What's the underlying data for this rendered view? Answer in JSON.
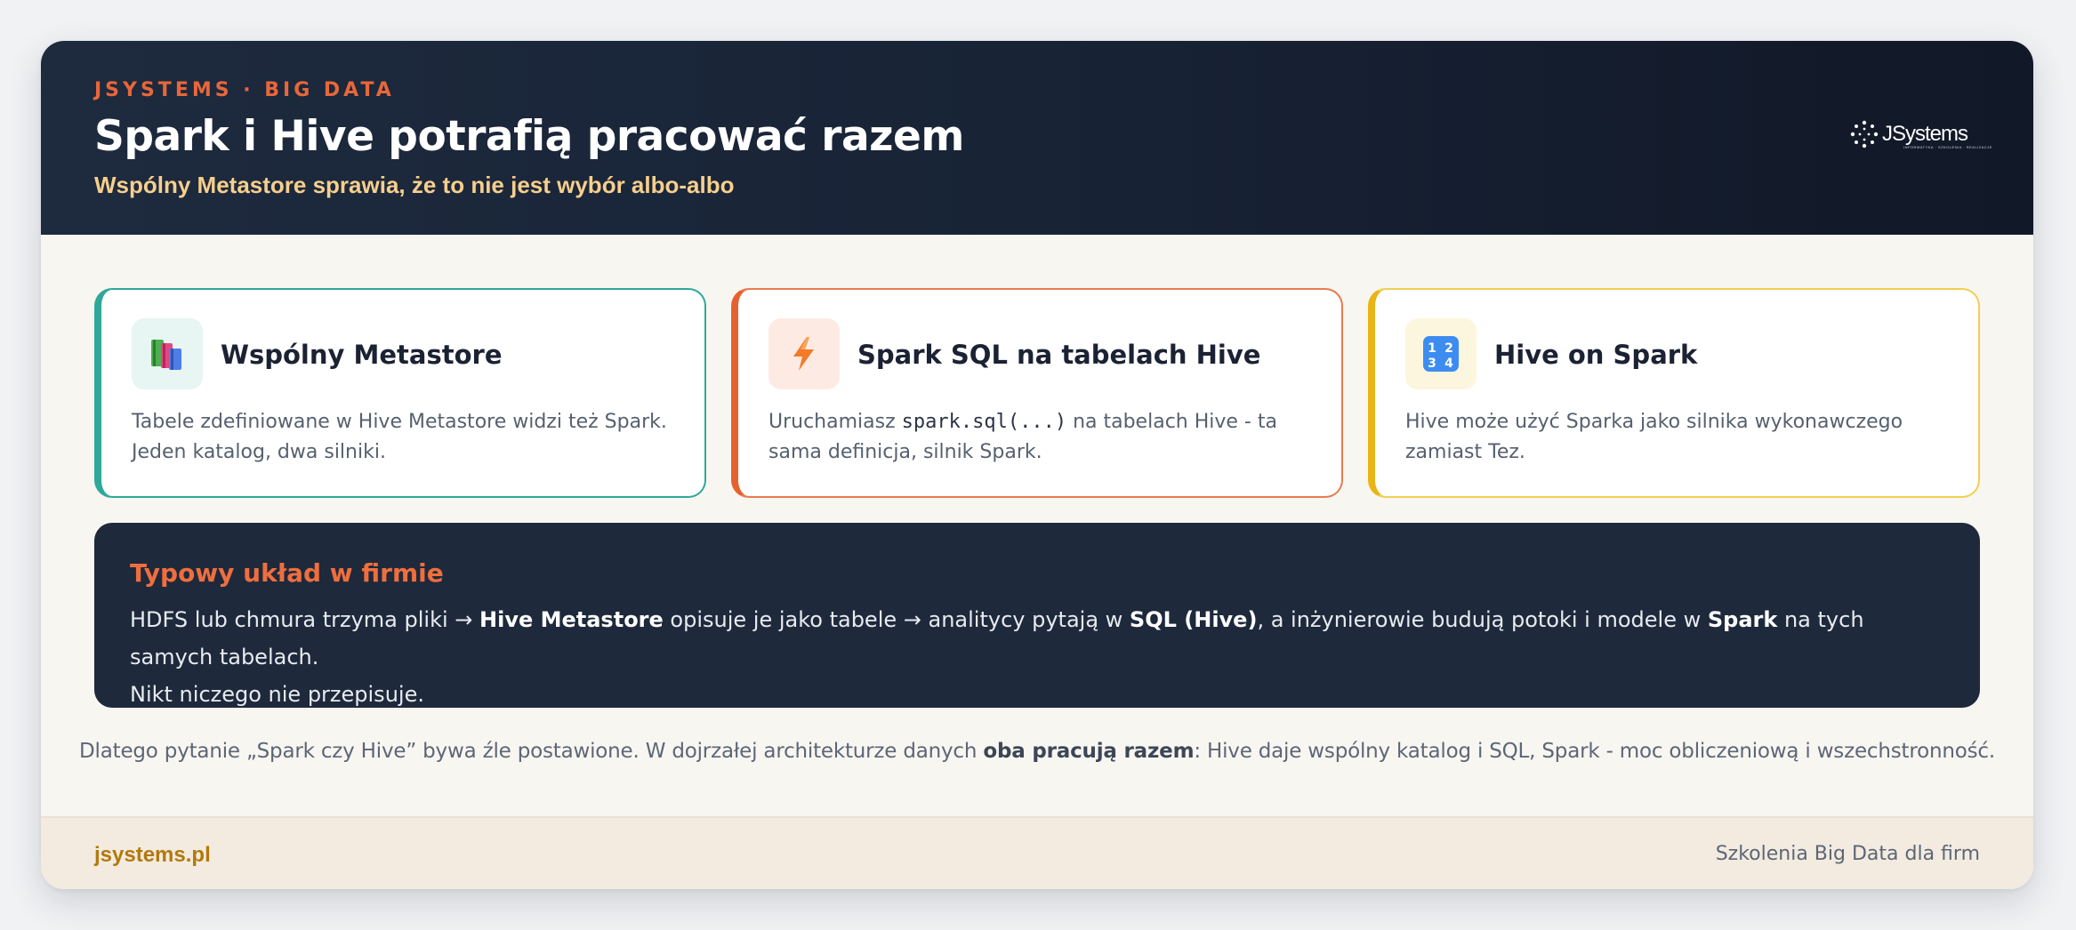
{
  "header": {
    "kicker": "JSYSTEMS · BIG DATA",
    "title": "Spark i Hive potrafią pracować razem",
    "subtitle": "Wspólny Metastore sprawia, że to nie jest wybór albo-albo",
    "logo": {
      "text": "JSystems",
      "tagline": "INFORMATYKA · SZKOLENIA · REALIZACJE",
      "icon": "jsystems-logo-icon"
    }
  },
  "cards": [
    {
      "icon": "books-icon",
      "title": "Wspólny Metastore",
      "desc_line1": "Tabele zdefiniowane w Hive Metastore widzi też Spark.",
      "desc_line2": "Jeden katalog, dwa silniki.",
      "accent": "#2fa89a"
    },
    {
      "icon": "lightning-icon",
      "title": "Spark SQL na tabelach Hive",
      "desc_pre": "Uruchamiasz ",
      "desc_code": "spark.sql(...)",
      "desc_post": " na tabelach Hive - ta sama definicja, silnik Spark.",
      "accent": "#e4622f"
    },
    {
      "icon": "numbers-1234-icon",
      "title": "Hive on Spark",
      "desc_line1": "Hive może użyć Sparka jako silnika wykonawczego",
      "desc_line2": "zamiast Tez.",
      "accent": "#e9b516"
    }
  ],
  "typical": {
    "title": "Typowy układ w firmie",
    "t1": "HDFS lub chmura trzyma pliki → ",
    "b1": "Hive Metastore",
    "t2": " opisuje je jako tabele → analitycy pytają w ",
    "b2": "SQL (Hive)",
    "t3": ", a inżynierowie budują potoki i modele w ",
    "b3": "Spark",
    "t4": " na tych samych tabelach.",
    "line2": "Nikt niczego nie przepisuje."
  },
  "summary": {
    "pre": "Dlatego pytanie „Spark czy Hive” bywa źle postawione. W dojrzałej architekturze danych ",
    "bold": "oba pracują razem",
    "post": ": Hive daje wspólny katalog i SQL, Spark - moc obliczeniową i wszechstronność."
  },
  "footer": {
    "left": "jsystems.pl",
    "right": "Szkolenia Big Data dla firm"
  },
  "colors": {
    "header_bg": "#1e2a3e",
    "accent_orange": "#e8673a",
    "accent_teal": "#2fa89a",
    "accent_yellow": "#e9b516",
    "subtitle": "#f6cf8c",
    "footer_link": "#b2790c"
  }
}
